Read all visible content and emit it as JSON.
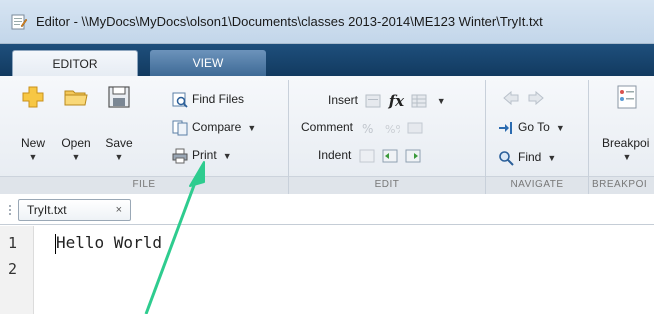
{
  "window": {
    "title": "Editor - \\\\MyDocs\\MyDocs\\olson1\\Documents\\classes 2013-2014\\ME123 Winter\\TryIt.txt",
    "icon": "editor-app-icon"
  },
  "tabs": {
    "editor": "EDITOR",
    "view": "VIEW"
  },
  "ribbon": {
    "file": {
      "group_label": "FILE",
      "new_label": "New",
      "open_label": "Open",
      "save_label": "Save",
      "find_files_label": "Find Files",
      "compare_label": "Compare",
      "print_label": "Print",
      "dropdown_glyph": "▼"
    },
    "edit": {
      "group_label": "EDIT",
      "insert_label": "Insert",
      "comment_label": "Comment",
      "indent_label": "Indent",
      "fx_label": "fx"
    },
    "navigate": {
      "group_label": "NAVIGATE",
      "goto_label": "Go To",
      "find_label": "Find"
    },
    "breakpoints": {
      "group_label": "BREAKPOI",
      "breakpoints_label": "Breakpoi"
    }
  },
  "editor": {
    "file_tab_label": "TryIt.txt",
    "close_glyph": "×",
    "lines": [
      {
        "number": "1",
        "text": "Hello World"
      },
      {
        "number": "2",
        "text": ""
      }
    ]
  },
  "colors": {
    "tabstrip": "#1e4f7c",
    "annotation_arrow": "#2ecc8f"
  }
}
